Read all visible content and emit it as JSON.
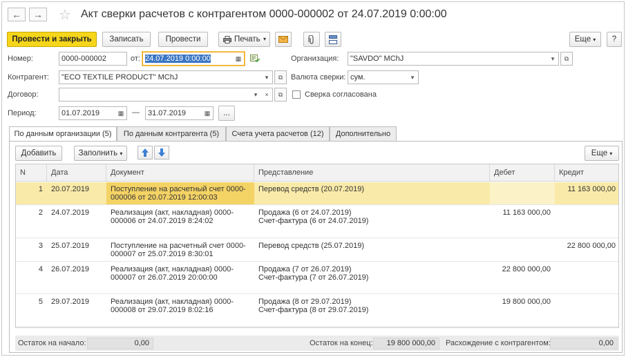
{
  "window": {
    "title": "Акт сверки расчетов с контрагентом 0000-000002 от 24.07.2019 0:00:00",
    "back_icon": "←",
    "forward_icon": "→",
    "favorite_icon": "☆"
  },
  "toolbar": {
    "post_close": "Провести и закрыть",
    "save": "Записать",
    "post": "Провести",
    "print": "Печать",
    "more": "Еще",
    "help": "?"
  },
  "form": {
    "number_label": "Номер:",
    "number_value": "0000-000002",
    "date_label": "от:",
    "date_value": "24.07.2019  0:00:00",
    "org_label": "Организация:",
    "org_value": "\"SAVDO\" MChJ",
    "counterparty_label": "Контрагент:",
    "counterparty_value": "\"ECO TEXTILE PRODUCT\" MChJ",
    "currency_label": "Валюта сверки:",
    "currency_value": "сум.",
    "contract_label": "Договор:",
    "contract_value": "",
    "agreed_label": "Сверка согласована",
    "period_label": "Период:",
    "period_from": "01.07.2019",
    "period_dash": "—",
    "period_to": "31.07.2019",
    "period_pick": "..."
  },
  "tabs": [
    {
      "label": "По данным организации (5)"
    },
    {
      "label": "По данным контрагента (5)"
    },
    {
      "label": "Счета учета расчетов (12)"
    },
    {
      "label": "Дополнительно"
    }
  ],
  "table_toolbar": {
    "add": "Добавить",
    "fill": "Заполнить",
    "more": "Еще"
  },
  "table": {
    "columns": [
      "N",
      "Дата",
      "Документ",
      "Представление",
      "Дебет",
      "Кредит"
    ],
    "rows": [
      {
        "n": "1",
        "date": "20.07.2019",
        "doc": "Поступление на расчетный счет 0000-\n000006 от 20.07.2019 12:00:03",
        "repr": "Перевод средств (20.07.2019)",
        "debit": "",
        "credit": "11 163 000,00"
      },
      {
        "n": "2",
        "date": "24.07.2019",
        "doc": "Реализация (акт, накладная) 0000-\n000006 от 24.07.2019 8:24:02",
        "repr": "Продажа (6 от 24.07.2019)\nСчет-фактура (6 от 24.07.2019)",
        "debit": "11 163 000,00",
        "credit": ""
      },
      {
        "n": "3",
        "date": "25.07.2019",
        "doc": "Поступление на расчетный счет 0000-\n000007 от 25.07.2019 8:30:01",
        "repr": "Перевод средств (25.07.2019)",
        "debit": "",
        "credit": "22 800 000,00"
      },
      {
        "n": "4",
        "date": "26.07.2019",
        "doc": "Реализация (акт, накладная) 0000-\n000007 от 26.07.2019 20:00:00",
        "repr": "Продажа (7 от 26.07.2019)\nСчет-фактура (7 от 26.07.2019)",
        "debit": "22 800 000,00",
        "credit": ""
      },
      {
        "n": "5",
        "date": "29.07.2019",
        "doc": "Реализация (акт, накладная) 0000-\n000008 от 29.07.2019 8:02:16",
        "repr": "Продажа (8 от 29.07.2019)\nСчет-фактура (8 от 29.07.2019)",
        "debit": "19 800 000,00",
        "credit": ""
      }
    ]
  },
  "footer": {
    "start_label": "Остаток на начало:",
    "start_value": "0,00",
    "end_label": "Остаток на конец:",
    "end_value": "19 800 000,00",
    "diff_label": "Расхождение с контрагентом:",
    "diff_value": "0,00"
  },
  "colors": {
    "primary_button": "#f5d61b",
    "selected_row": "#f9eaa9",
    "focus_border": "#f0a818"
  }
}
